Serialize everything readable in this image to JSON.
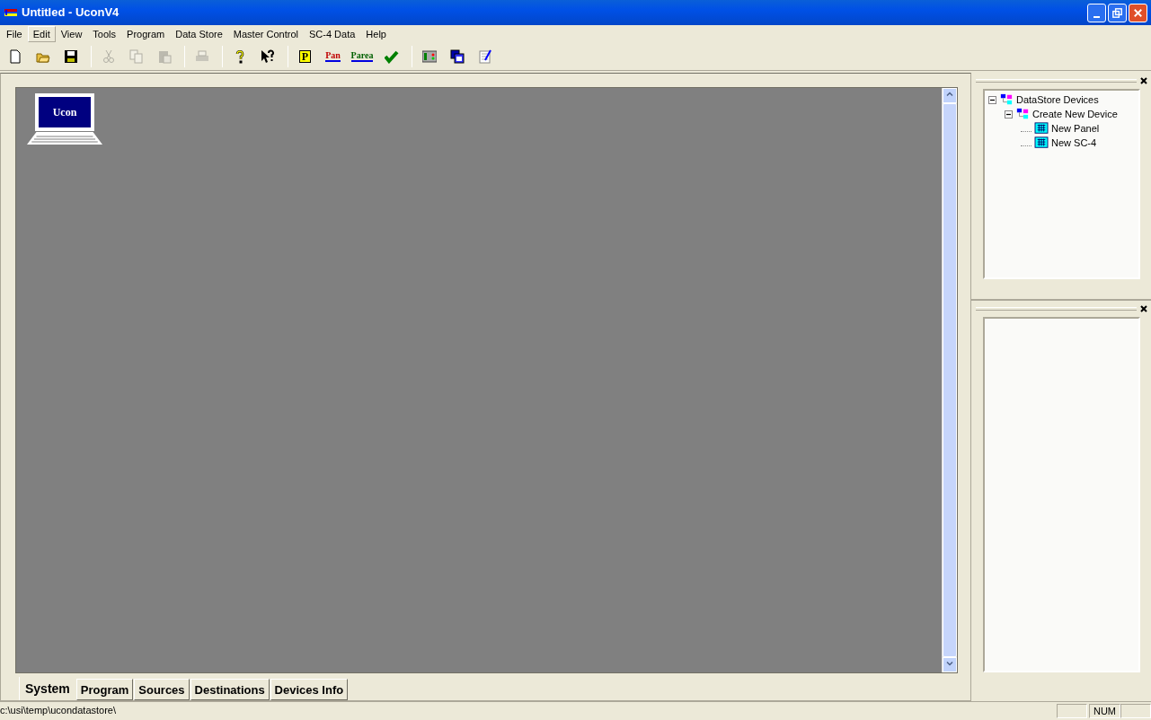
{
  "window": {
    "title": "Untitled - UconV4"
  },
  "menu": [
    {
      "label": "File",
      "selected": false
    },
    {
      "label": "Edit",
      "selected": true
    },
    {
      "label": "View",
      "selected": false
    },
    {
      "label": "Tools",
      "selected": false
    },
    {
      "label": "Program",
      "selected": false
    },
    {
      "label": "Data Store",
      "selected": false
    },
    {
      "label": "Master Control",
      "selected": false
    },
    {
      "label": "SC-4 Data",
      "selected": false
    },
    {
      "label": "Help",
      "selected": false
    }
  ],
  "toolbar": [
    [
      {
        "kind": "new",
        "disabled": false
      },
      {
        "kind": "open",
        "disabled": false
      },
      {
        "kind": "save",
        "disabled": false
      }
    ],
    [
      {
        "kind": "cut",
        "disabled": true
      },
      {
        "kind": "copy",
        "disabled": true
      },
      {
        "kind": "paste",
        "disabled": true
      }
    ],
    [
      {
        "kind": "print",
        "disabled": true
      }
    ],
    [
      {
        "kind": "help",
        "disabled": false
      },
      {
        "kind": "context-help",
        "disabled": false
      }
    ],
    [
      {
        "kind": "letter",
        "label": "P",
        "disabled": false
      },
      {
        "kind": "letter-arrow",
        "label": "Pan",
        "disabled": false
      },
      {
        "kind": "letter-arrow",
        "label": "Parea",
        "disabled": false
      },
      {
        "kind": "check",
        "disabled": false
      }
    ],
    [
      {
        "kind": "panel",
        "disabled": false
      },
      {
        "kind": "windows",
        "disabled": false
      },
      {
        "kind": "notes",
        "disabled": false
      }
    ]
  ],
  "canvas": {
    "devices": [
      {
        "label": "Ucon"
      }
    ]
  },
  "tabs": [
    {
      "label": "System",
      "selected": true
    },
    {
      "label": "Program",
      "selected": false
    },
    {
      "label": "Sources",
      "selected": false
    },
    {
      "label": "Destinations",
      "selected": false
    },
    {
      "label": "Devices Info",
      "selected": false
    }
  ],
  "tree": [
    {
      "label": "DataStore Devices",
      "kind": "group",
      "expanded": true,
      "children": [
        {
          "label": "Create New Device",
          "kind": "group",
          "expanded": true,
          "children": [
            {
              "label": "New Panel",
              "kind": "device"
            },
            {
              "label": "New SC-4",
              "kind": "device"
            }
          ]
        }
      ]
    }
  ],
  "status_bar": {
    "path": "c:\\usi\\temp\\ucondatastore\\",
    "indicators": [
      "NUM"
    ]
  }
}
